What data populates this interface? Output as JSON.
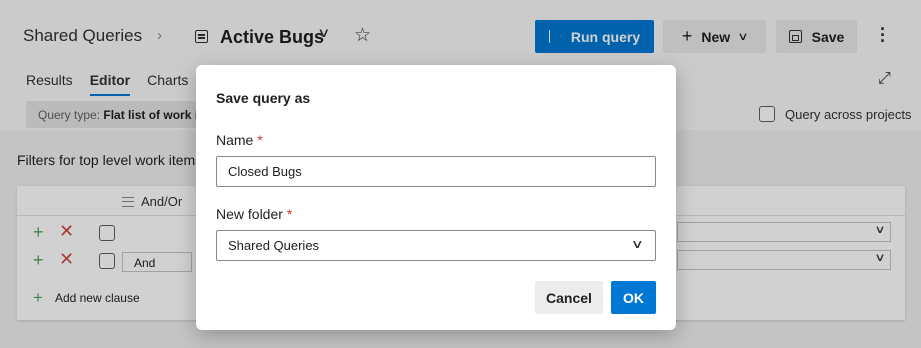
{
  "header": {
    "breadcrumb_root": "Shared Queries",
    "breadcrumb_separator": "›",
    "query_title": "Active Bugs",
    "run_query_label": "Run query",
    "new_label": "New",
    "save_label": "Save"
  },
  "tabs": [
    {
      "label": "Results",
      "active": false
    },
    {
      "label": "Editor",
      "active": true
    },
    {
      "label": "Charts",
      "active": false
    }
  ],
  "query_type": {
    "label": "Query type:",
    "value": "Flat list of work items"
  },
  "query_across_projects": {
    "label": "Query across projects",
    "checked": false
  },
  "filters_title": "Filters for top level work items",
  "grid": {
    "andor_header": "And/Or",
    "rows": [
      {
        "andor": ""
      },
      {
        "andor": "And"
      }
    ],
    "add_clause_label": "Add new clause"
  },
  "dialog": {
    "title": "Save query as",
    "name_label": "Name",
    "name_value": "Closed Bugs",
    "folder_label": "New folder",
    "folder_value": "Shared Queries",
    "required_mark": "*",
    "cancel_label": "Cancel",
    "ok_label": "OK"
  },
  "colors": {
    "accent": "#0078d4",
    "add_green": "#55a362",
    "remove_red": "#cd4a45",
    "required_red": "#d13438"
  },
  "icons": [
    "query-list-icon",
    "chevron-down-icon",
    "star-icon",
    "play-icon",
    "plus-icon",
    "save-disk-icon",
    "more-vertical-icon",
    "expand-icon"
  ]
}
